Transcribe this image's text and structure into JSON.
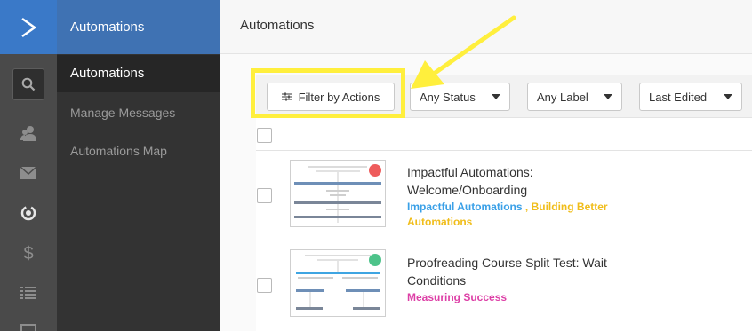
{
  "rail": {
    "icons": [
      "logo-chevron-icon",
      "search-icon",
      "contacts-icon",
      "envelope-icon",
      "automations-icon",
      "dollar-icon",
      "list-icon",
      "reports-icon"
    ]
  },
  "subnav": {
    "header": "Automations",
    "items": [
      {
        "label": "Automations"
      },
      {
        "label": "Manage Messages"
      },
      {
        "label": "Automations Map"
      }
    ]
  },
  "main": {
    "title": "Automations"
  },
  "toolbar": {
    "filter_label": "Filter by Actions",
    "status_select": "Any Status",
    "label_select": "Any Label",
    "sort_select": "Last Edited"
  },
  "automations": [
    {
      "title_line1": "Impactful Automations:",
      "title_line2": "Welcome/Onboarding",
      "tag1": "Impactful Automations",
      "separator": " , ",
      "tag2": "Building Better",
      "tag2b": "Automations",
      "status_color": "#ee5b5b"
    },
    {
      "title_line1": "Proofreading Course Split Test: Wait",
      "title_line2": "Conditions",
      "tag1": "Measuring Success",
      "status_color": "#4dc38a"
    }
  ],
  "colors": {
    "brand_blue": "#3f72b3",
    "highlight_yellow": "#ffef3d"
  }
}
